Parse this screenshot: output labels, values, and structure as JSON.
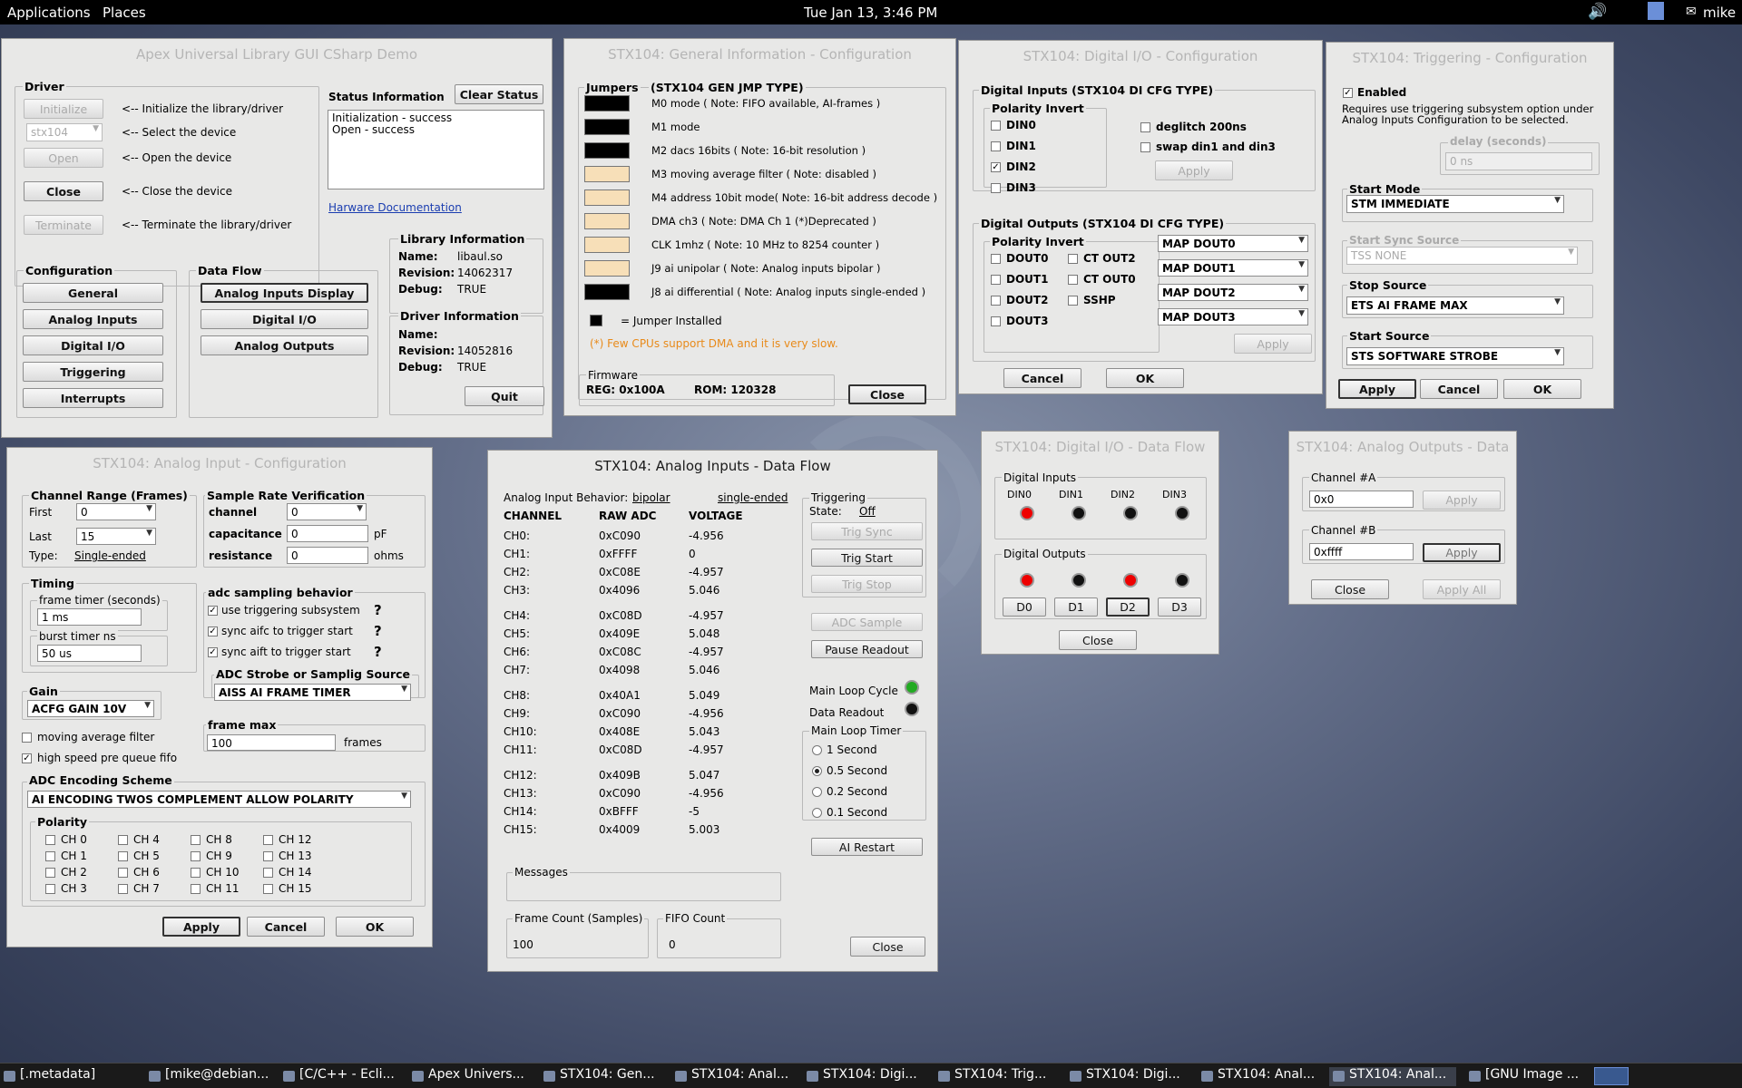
{
  "topbar": {
    "applications": "Applications",
    "places": "Places",
    "clock": "Tue Jan 13,  3:46 PM",
    "user": "mike"
  },
  "taskbar": {
    "items": [
      "[.metadata]",
      "[mike@debian...",
      "[C/C++ - Ecli...",
      "Apex Univers...",
      "STX104: Gen...",
      "STX104: Anal...",
      "STX104: Digi...",
      "STX104: Trig...",
      "STX104:  Digi...",
      "STX104: Anal...",
      "STX104: Anal...",
      "[GNU Image ..."
    ]
  },
  "main": {
    "title": "Apex Universal Library GUI CSharp Demo",
    "driver": {
      "label": "Driver",
      "initialize": "Initialize",
      "initialize_desc": "<-- Initialize the library/driver",
      "device": "stx104",
      "device_desc": "<-- Select the device",
      "open": "Open",
      "open_desc": "<-- Open the device",
      "close": "Close",
      "close_desc": "<-- Close the device",
      "terminate": "Terminate",
      "terminate_desc": "<-- Terminate the library/driver"
    },
    "status": {
      "label": "Status Information",
      "clear": "Clear Status",
      "line1": "Initialization - success",
      "line2": "Open - success",
      "doc_link": "Harware Documentation"
    },
    "library": {
      "label": "Library Information",
      "name_l": "Name:",
      "name": "libaul.so",
      "rev_l": "Revision:",
      "rev": "14062317",
      "dbg_l": "Debug:",
      "dbg": "TRUE"
    },
    "drv": {
      "label": "Driver Information",
      "name_l": "Name:",
      "name": "",
      "rev_l": "Revision:",
      "rev": "14052816",
      "dbg_l": "Debug:",
      "dbg": "TRUE"
    },
    "config": {
      "label": "Configuration",
      "general": "General",
      "analog_inputs": "Analog Inputs",
      "digital_io": "Digital I/O",
      "triggering": "Triggering",
      "interrupts": "Interrupts"
    },
    "dataflow": {
      "label": "Data Flow",
      "aid": "Analog Inputs Display",
      "dio": "Digital I/O",
      "ao": "Analog Outputs"
    },
    "quit": "Quit"
  },
  "gen": {
    "title": "STX104: General Information - Configuration",
    "jumpers": "Jumpers",
    "jumpers_type": "(STX104 GEN JMP TYPE)",
    "rows": [
      {
        "state": "on",
        "text": "M0  mode           (  Note: FIFO available, AI-frames )"
      },
      {
        "state": "on",
        "text": "M1  mode"
      },
      {
        "state": "on",
        "text": "M2  dacs 16bits      ( Note: 16-bit resolution )"
      },
      {
        "state": "off",
        "text": "M3  moving average  filter    ( Note: disabled )"
      },
      {
        "state": "off",
        "text": "M4  address 10bit mode( Note: 16-bit address decode )"
      },
      {
        "state": "off",
        "text": "DMA  ch3          ( Note: DMA Ch 1 (*)Deprecated )"
      },
      {
        "state": "off",
        "text": "CLK  1mhz         ( Note: 10 MHz to 8254 counter )"
      },
      {
        "state": "off",
        "text": "J9  ai  unipolar          ( Note: Analog inputs bipolar )"
      },
      {
        "state": "on",
        "text": "J8  ai  differential    ( Note: Analog inputs single-ended )"
      }
    ],
    "legend": "= Jumper Installed",
    "warn": "(*) Few CPUs support  DMA and it is very slow.",
    "firmware": "Firmware",
    "reg": "REG: 0x100A",
    "rom": "ROM: 120328",
    "close": "Close"
  },
  "dio": {
    "title": "STX104: Digital I/O - Configuration",
    "di_label": "Digital Inputs (STX104 DI CFG TYPE)",
    "pol_inv": "Polarity Invert",
    "din": [
      {
        "label": "DIN0",
        "checked": false
      },
      {
        "label": "DIN1",
        "checked": false
      },
      {
        "label": "DIN2",
        "checked": true
      },
      {
        "label": "DIN3",
        "checked": false
      }
    ],
    "deglitch": "deglitch 200ns",
    "swap": "swap din1 and din3",
    "apply1": "Apply",
    "do_label": "Digital Outputs (STX104 DI CFG TYPE)",
    "pol_inv2": "Polarity Invert",
    "dout": [
      "DOUT0",
      "DOUT1",
      "DOUT2",
      "DOUT3"
    ],
    "ct": [
      "CT OUT2",
      "CT OUT0",
      "SSHP"
    ],
    "maps": [
      "MAP DOUT0",
      "MAP DOUT1",
      "MAP DOUT2",
      "MAP DOUT3"
    ],
    "apply2": "Apply",
    "cancel": "Cancel",
    "ok": "OK"
  },
  "trig": {
    "title": "STX104: Triggering - Configuration",
    "enabled": "Enabled",
    "desc1": "Requires use triggering subsystem option under",
    "desc2": "Analog Inputs Configuration to be selected.",
    "delay_label": "delay (seconds)",
    "delay": "0 ns",
    "start_mode_l": "Start Mode",
    "start_mode": "STM IMMEDIATE",
    "sync_l": "Start Sync Source",
    "sync": "TSS NONE",
    "stop_l": "Stop Source",
    "stop": "ETS AI FRAME MAX",
    "start_src_l": "Start Source",
    "start_src": "STS SOFTWARE STROBE",
    "apply": "Apply",
    "cancel": "Cancel",
    "ok": "OK"
  },
  "aicfg": {
    "title": "STX104: Analog Input - Configuration",
    "cr_label": "Channel Range (Frames)",
    "first_l": "First",
    "first": "0",
    "last_l": "Last",
    "last": "15",
    "type_l": "Type:",
    "type": "Single-ended",
    "srv_label": "Sample Rate Verification",
    "channel_l": "channel",
    "channel": "0",
    "cap_l": "capacitance",
    "cap": "0",
    "cap_u": "pF",
    "res_l": "resistance",
    "res": "0",
    "res_u": "ohms",
    "timing": "Timing",
    "ft_l": "frame timer (seconds)",
    "ft": "1 ms",
    "bt_l": "burst timer ns",
    "bt": "50 us",
    "asb": "adc sampling behavior",
    "uts": "use triggering subsystem",
    "saifc": "sync aifc to trigger start",
    "saift": "sync aift to trigger start",
    "help": "?",
    "strobe_l": "ADC Strobe or Samplig Source",
    "strobe": "AISS AI FRAME TIMER",
    "gain_l": "Gain",
    "gain": "ACFG GAIN 10V",
    "fm_l": "frame max",
    "fm": "100",
    "fm_u": "frames",
    "maf": "moving average filter",
    "hspq": "high speed pre queue fifo",
    "enc_l": "ADC Encoding Scheme",
    "enc": "AI ENCODING TWOS COMPLEMENT ALLOW POLARITY",
    "pol_l": "Polarity",
    "ch": [
      "CH 0",
      "CH 4",
      "CH 8",
      "CH 12",
      "CH 1",
      "CH 5",
      "CH 9",
      "CH 13",
      "CH 2",
      "CH 6",
      "CH 10",
      "CH 14",
      "CH 3",
      "CH 7",
      "CH 11",
      "CH 15"
    ],
    "apply": "Apply",
    "cancel": "Cancel",
    "ok": "OK"
  },
  "aidf": {
    "title": "STX104: Analog Inputs - Data Flow",
    "behavior_l": "Analog Input Behavior:",
    "bipolar": "bipolar",
    "single": "single-ended",
    "h_ch": "CHANNEL",
    "h_raw": "RAW ADC",
    "h_v": "VOLTAGE",
    "rows": [
      {
        "ch": "CH0:",
        "raw": "0xC090",
        "v": "-4.956"
      },
      {
        "ch": "CH1:",
        "raw": "0xFFFF",
        "v": "0"
      },
      {
        "ch": "CH2:",
        "raw": "0xC08E",
        "v": "-4.957"
      },
      {
        "ch": "CH3:",
        "raw": "0x4096",
        "v": "5.046"
      },
      {
        "ch": "CH4:",
        "raw": "0xC08D",
        "v": "-4.957"
      },
      {
        "ch": "CH5:",
        "raw": "0x409E",
        "v": "5.048"
      },
      {
        "ch": "CH6:",
        "raw": "0xC08C",
        "v": "-4.957"
      },
      {
        "ch": "CH7:",
        "raw": "0x4098",
        "v": "5.046"
      },
      {
        "ch": "CH8:",
        "raw": "0x40A1",
        "v": "5.049"
      },
      {
        "ch": "CH9:",
        "raw": "0xC090",
        "v": "-4.956"
      },
      {
        "ch": "CH10:",
        "raw": "0x408E",
        "v": "5.043"
      },
      {
        "ch": "CH11:",
        "raw": "0xC08D",
        "v": "-4.957"
      },
      {
        "ch": "CH12:",
        "raw": "0x409B",
        "v": "5.047"
      },
      {
        "ch": "CH13:",
        "raw": "0xC090",
        "v": "-4.956"
      },
      {
        "ch": "CH14:",
        "raw": "0xBFFF",
        "v": "-5"
      },
      {
        "ch": "CH15:",
        "raw": "0x4009",
        "v": "5.003"
      }
    ],
    "trig_l": "Triggering",
    "state_l": "State:",
    "state": "Off",
    "trig_sync": "Trig Sync",
    "trig_start": "Trig Start",
    "trig_stop": "Trig Stop",
    "adc_sample": "ADC Sample",
    "pause": "Pause Readout",
    "mlc": "Main Loop Cycle",
    "dr": "Data Readout",
    "mlt_l": "Main Loop Timer",
    "r1": "1 Second",
    "r2": "0.5 Second",
    "r3": "0.2 Second",
    "r4": "0.1 Second",
    "ai_restart": "AI Restart",
    "messages": "Messages",
    "fc_l": "Frame Count (Samples)",
    "fc": "100",
    "fifo_l": "FIFO Count",
    "fifo": "0",
    "close": "Close"
  },
  "diodf": {
    "title": "STX104:  Digital I/O - Data Flow",
    "di_l": "Digital Inputs",
    "din": [
      "DIN0",
      "DIN1",
      "DIN2",
      "DIN3"
    ],
    "do_l": "Digital Outputs",
    "d": [
      "D0",
      "D1",
      "D2",
      "D3"
    ],
    "close": "Close"
  },
  "aodf": {
    "title": "STX104: Analog Outputs - Data",
    "cha_l": "Channel #A",
    "cha": "0x0",
    "chb_l": "Channel #B",
    "chb": "0xffff",
    "apply": "Apply",
    "close": "Close",
    "apply_all": "Apply All"
  }
}
